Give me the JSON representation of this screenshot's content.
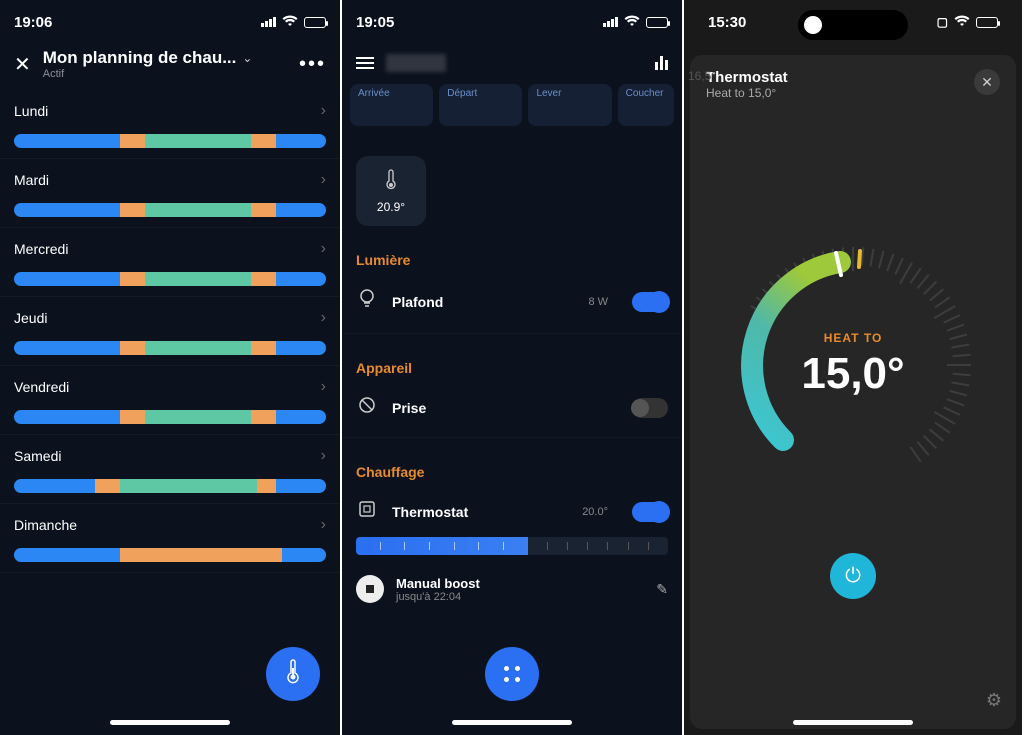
{
  "panel1": {
    "status": {
      "time": "19:06"
    },
    "header": {
      "title": "Mon planning de chau...",
      "subtitle": "Actif"
    },
    "days": [
      {
        "label": "Lundi",
        "segments": [
          [
            "blue",
            34
          ],
          [
            "orange",
            8
          ],
          [
            "green",
            34
          ],
          [
            "orange",
            8
          ],
          [
            "blue",
            16
          ]
        ]
      },
      {
        "label": "Mardi",
        "segments": [
          [
            "blue",
            34
          ],
          [
            "orange",
            8
          ],
          [
            "green",
            34
          ],
          [
            "orange",
            8
          ],
          [
            "blue",
            16
          ]
        ]
      },
      {
        "label": "Mercredi",
        "segments": [
          [
            "blue",
            34
          ],
          [
            "orange",
            8
          ],
          [
            "green",
            34
          ],
          [
            "orange",
            8
          ],
          [
            "blue",
            16
          ]
        ]
      },
      {
        "label": "Jeudi",
        "segments": [
          [
            "blue",
            34
          ],
          [
            "orange",
            8
          ],
          [
            "green",
            34
          ],
          [
            "orange",
            8
          ],
          [
            "blue",
            16
          ]
        ]
      },
      {
        "label": "Vendredi",
        "segments": [
          [
            "blue",
            34
          ],
          [
            "orange",
            8
          ],
          [
            "green",
            34
          ],
          [
            "orange",
            8
          ],
          [
            "blue",
            16
          ]
        ]
      },
      {
        "label": "Samedi",
        "segments": [
          [
            "blue",
            26
          ],
          [
            "orange",
            8
          ],
          [
            "green",
            44
          ],
          [
            "orange",
            6
          ],
          [
            "blue",
            16
          ]
        ]
      },
      {
        "label": "Dimanche",
        "segments": [
          [
            "blue",
            34
          ],
          [
            "orange",
            52
          ],
          [
            "blue",
            14
          ]
        ]
      }
    ]
  },
  "panel2": {
    "status": {
      "time": "19:05"
    },
    "events": [
      "Arrivée",
      "Départ",
      "Lever",
      "Coucher"
    ],
    "tempTile": "20.9°",
    "sections": {
      "light": {
        "title": "Lumière",
        "device": "Plafond",
        "meta": "8 W",
        "on": true
      },
      "appliance": {
        "title": "Appareil",
        "device": "Prise",
        "on": false
      },
      "heating": {
        "title": "Chauffage",
        "device": "Thermostat",
        "meta": "20.0°",
        "on": true
      }
    },
    "boost": {
      "title": "Manual boost",
      "subtitle": "jusqu'à 22:04"
    },
    "thermo_fill_pct": 55
  },
  "panel3": {
    "status": {
      "time": "15:30"
    },
    "ambient": "16,5°",
    "title": "Thermostat",
    "subtitle": "Heat to 15,0°",
    "heat_to_label": "HEAT TO",
    "heat_to_value": "15,0°"
  },
  "colors": {
    "accent_blue": "#2b6ff2",
    "accent_orange": "#e88a2e",
    "seg_blue": "#2b87f3",
    "seg_orange": "#f0a25c",
    "seg_green": "#5ec7a3",
    "power_cyan": "#1fb6d9"
  }
}
